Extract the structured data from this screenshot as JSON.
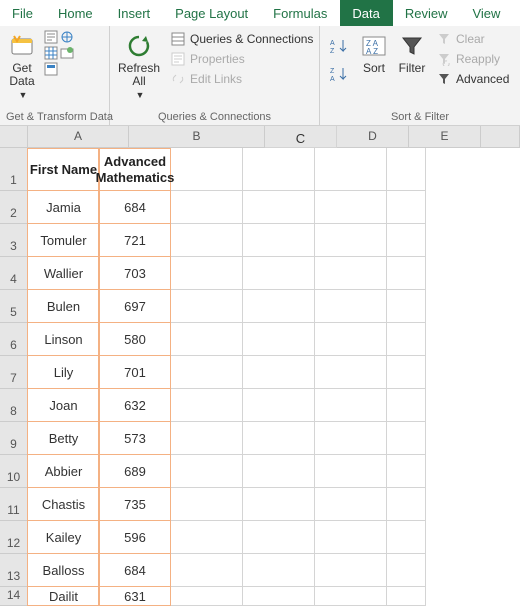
{
  "tabs": [
    "File",
    "Home",
    "Insert",
    "Page Layout",
    "Formulas",
    "Data",
    "Review",
    "View"
  ],
  "activeTab": 5,
  "ribbon": {
    "getTransform": {
      "label": "Get & Transform Data",
      "getData": "Get\nData"
    },
    "queries": {
      "label": "Queries & Connections",
      "refreshAll": "Refresh\nAll",
      "qc": "Queries & Connections",
      "props": "Properties",
      "editLinks": "Edit Links"
    },
    "sortFilter": {
      "label": "Sort & Filter",
      "sort": "Sort",
      "filter": "Filter",
      "clear": "Clear",
      "reapply": "Reapply",
      "advanced": "Advanced"
    }
  },
  "columns": [
    "A",
    "B",
    "C",
    "D",
    "E"
  ],
  "header": {
    "colA": "First Name",
    "colB": "Advanced\nMathematics"
  },
  "rows": [
    {
      "n": 1
    },
    {
      "n": 2,
      "a": "Jamia",
      "b": "684"
    },
    {
      "n": 3,
      "a": "Tomuler",
      "b": "721"
    },
    {
      "n": 4,
      "a": "Wallier",
      "b": "703"
    },
    {
      "n": 5,
      "a": "Bulen",
      "b": "697"
    },
    {
      "n": 6,
      "a": "Linson",
      "b": "580"
    },
    {
      "n": 7,
      "a": "Lily",
      "b": "701"
    },
    {
      "n": 8,
      "a": "Joan",
      "b": "632"
    },
    {
      "n": 9,
      "a": "Betty",
      "b": "573"
    },
    {
      "n": 10,
      "a": "Abbier",
      "b": "689"
    },
    {
      "n": 11,
      "a": "Chastis",
      "b": "735"
    },
    {
      "n": 12,
      "a": "Kailey",
      "b": "596"
    },
    {
      "n": 13,
      "a": "Balloss",
      "b": "684"
    },
    {
      "n": 14,
      "a": "Dailit",
      "b": "631"
    }
  ]
}
